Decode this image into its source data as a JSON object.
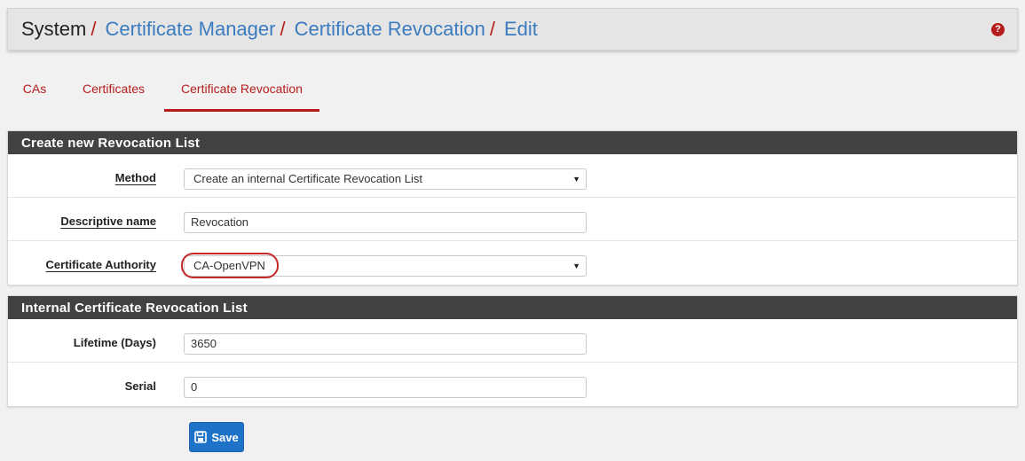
{
  "breadcrumb": {
    "root": "System",
    "separator": "/",
    "items": [
      "Certificate Manager",
      "Certificate Revocation",
      "Edit"
    ]
  },
  "header_icons": {
    "help": "question-circle-icon"
  },
  "tabs": [
    {
      "label": "CAs",
      "active": false
    },
    {
      "label": "Certificates",
      "active": false
    },
    {
      "label": "Certificate Revocation",
      "active": true
    }
  ],
  "panel_create": {
    "title": "Create new Revocation List",
    "method": {
      "label": "Method",
      "value": "Create an internal Certificate Revocation List"
    },
    "descriptive_name": {
      "label": "Descriptive name",
      "value": "Revocation"
    },
    "certificate_authority": {
      "label": "Certificate Authority",
      "value": "CA-OpenVPN"
    }
  },
  "panel_internal": {
    "title": "Internal Certificate Revocation List",
    "lifetime": {
      "label": "Lifetime (Days)",
      "value": "3650"
    },
    "serial": {
      "label": "Serial",
      "value": "0"
    }
  },
  "save_button": {
    "label": "Save",
    "icon": "save-icon"
  },
  "colors": {
    "accent": "#b71c1c",
    "link": "#3b7cc0",
    "primary_button": "#1e73c8",
    "panel_heading": "#424242"
  }
}
